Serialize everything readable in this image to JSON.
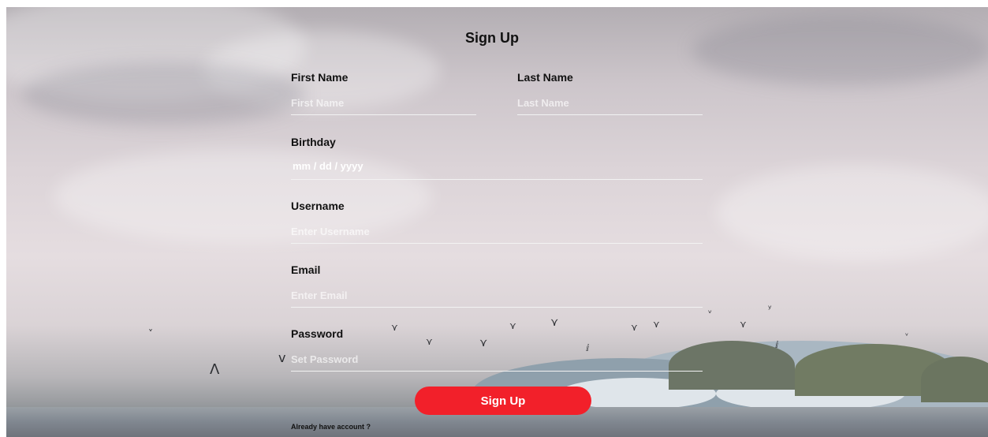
{
  "form": {
    "title": "Sign Up",
    "first_name": {
      "label": "First Name",
      "placeholder": "First Name"
    },
    "last_name": {
      "label": "Last Name",
      "placeholder": "Last Name"
    },
    "birthday": {
      "label": "Birthday",
      "value": "mm / dd / yyyy"
    },
    "username": {
      "label": "Username",
      "placeholder": "Enter Username"
    },
    "email": {
      "label": "Email",
      "placeholder": "Enter Email"
    },
    "password": {
      "label": "Password",
      "placeholder": "Set Password"
    },
    "submit_label": "Sign Up",
    "signin_prompt": "Already have account ?"
  },
  "colors": {
    "button": "#f2202a",
    "text": "#111111",
    "field_line": "#f2f2f2"
  }
}
